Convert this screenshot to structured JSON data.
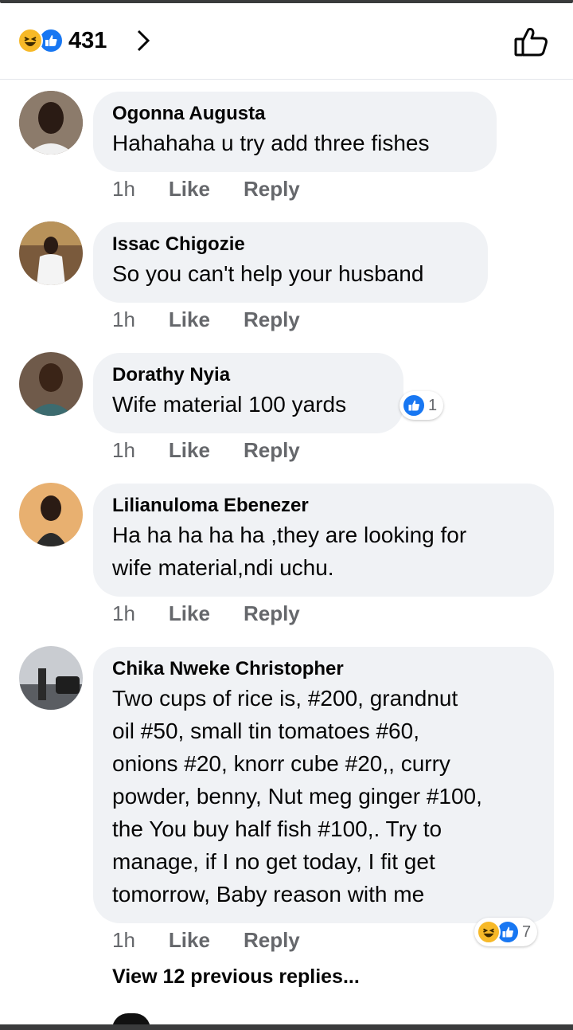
{
  "header": {
    "reaction_count": "431",
    "reaction_icons": [
      "haha-icon",
      "like-icon"
    ]
  },
  "comments": [
    {
      "name": "Ogonna Augusta",
      "text": "Hahahaha u try add three fishes",
      "time": "1h",
      "like": "Like",
      "reply": "Reply"
    },
    {
      "name": "Issac Chigozie",
      "text": "So you can't help your husband",
      "time": "1h",
      "like": "Like",
      "reply": "Reply"
    },
    {
      "name": "Dorathy Nyia",
      "text": "Wife material 100 yards",
      "time": "1h",
      "like": "Like",
      "reply": "Reply",
      "reaction_count": "1"
    },
    {
      "name": "Lilianuloma Ebenezer",
      "text_lines": [
        "Ha ha ha ha ha ,they are looking for",
        "wife material,ndi uchu."
      ],
      "time": "1h",
      "like": "Like",
      "reply": "Reply"
    },
    {
      "name": "Chika Nweke Christopher",
      "text_lines": [
        "Two cups of rice is, #200, grandnut",
        "oil #50, small tin tomatoes #60,",
        "onions #20, knorr cube #20,, curry",
        "powder, benny,  Nut meg ginger #100,",
        "the You buy half fish #100,. Try to",
        "manage,  if I no get today,  I fit get",
        "tomorrow,  Baby reason with me"
      ],
      "time": "1h",
      "like": "Like",
      "reply": "Reply",
      "reaction_count": "7"
    }
  ],
  "view_replies": "View 12 previous replies...",
  "colors": {
    "bubble": "#f0f2f5",
    "like_blue": "#1877f2",
    "haha_yellow": "#f7b928",
    "meta_gray": "#65676b"
  }
}
